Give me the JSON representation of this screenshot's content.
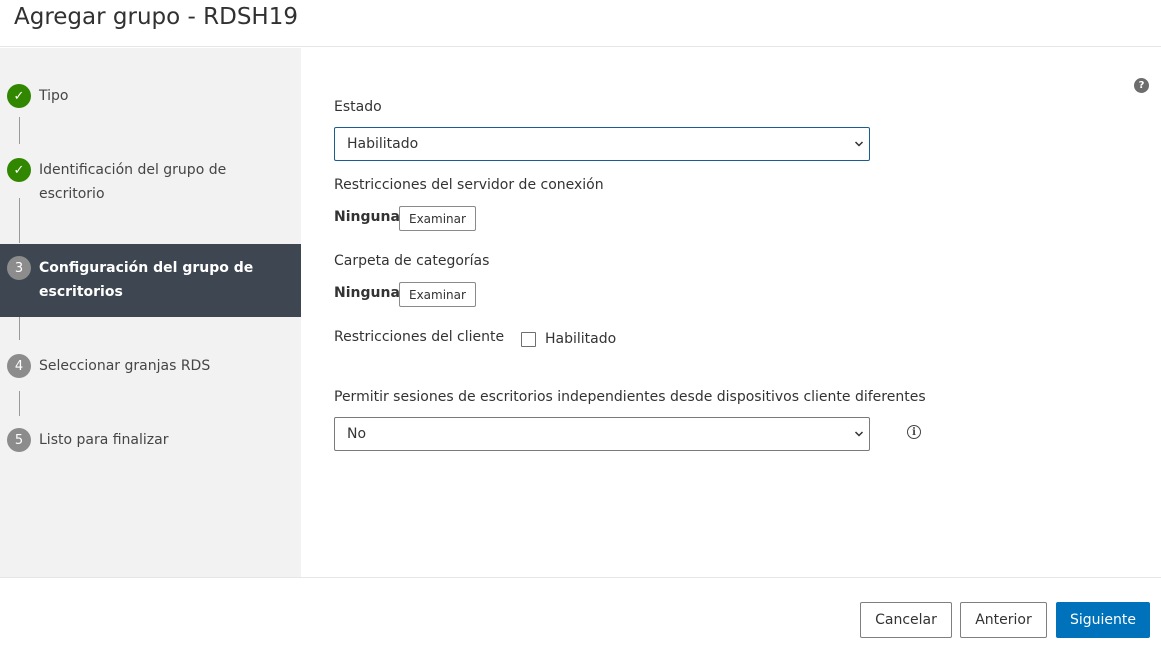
{
  "header": {
    "title": "Agregar grupo - RDSH19"
  },
  "wizard": {
    "steps": [
      {
        "marker": "✓",
        "label_line1": "Tipo",
        "label_line2": "",
        "state": "done"
      },
      {
        "marker": "✓",
        "label_line1": "Identificación del grupo de",
        "label_line2": "escritorio",
        "state": "done"
      },
      {
        "marker": "3",
        "label_line1": "Configuración del grupo de",
        "label_line2": "escritorios",
        "state": "current"
      },
      {
        "marker": "4",
        "label_line1": "Seleccionar granjas RDS",
        "label_line2": "",
        "state": "todo"
      },
      {
        "marker": "5",
        "label_line1": "Listo para finalizar",
        "label_line2": "",
        "state": "todo"
      }
    ]
  },
  "form": {
    "help_icon": "?",
    "estado": {
      "label": "Estado",
      "value": "Habilitado"
    },
    "connection_server": {
      "label": "Restricciones del servidor de conexión",
      "value": "Ninguna",
      "button": "Examinar"
    },
    "category_folder": {
      "label": "Carpeta de categorías",
      "value": "Ninguna",
      "button": "Examinar"
    },
    "client_restrictions": {
      "label": "Restricciones del cliente",
      "checkbox_label": "Habilitado",
      "checked": false
    },
    "separate_sessions": {
      "label": "Permitir sesiones de escritorios independientes desde dispositivos cliente diferentes",
      "value": "No",
      "info_icon": "i"
    }
  },
  "footer": {
    "cancel": "Cancelar",
    "back": "Anterior",
    "next": "Siguiente"
  },
  "colors": {
    "done": "#318700",
    "active_bg": "#3e4651",
    "primary": "#0072bc"
  }
}
